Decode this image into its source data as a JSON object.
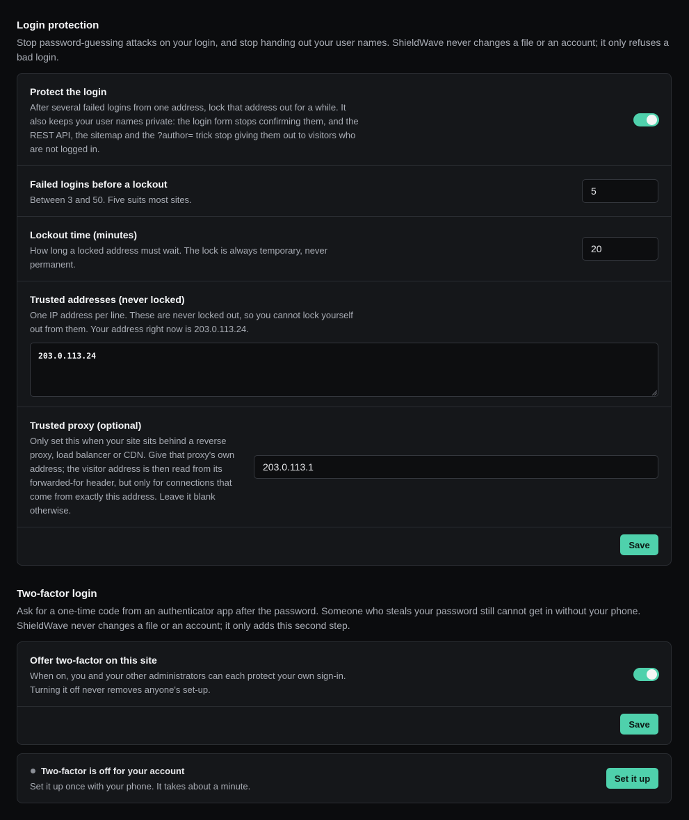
{
  "login_protection": {
    "title": "Login protection",
    "description": "Stop password-guessing attacks on your login, and stop handing out your user names. ShieldWave never changes a file or an account; it only refuses a bad login.",
    "protect": {
      "title": "Protect the login",
      "description": "After several failed logins from one address, lock that address out for a while. It also keeps your user names private: the login form stops confirming them, and the REST API, the sitemap and the ?author= trick stop giving them out to visitors who are not logged in.",
      "enabled": true
    },
    "failed_logins": {
      "title": "Failed logins before a lockout",
      "description": "Between 3 and 50. Five suits most sites.",
      "value": "5"
    },
    "lockout_time": {
      "title": "Lockout time (minutes)",
      "description": "How long a locked address must wait. The lock is always temporary, never permanent.",
      "value": "20"
    },
    "trusted_addresses": {
      "title": "Trusted addresses (never locked)",
      "description": "One IP address per line. These are never locked out, so you cannot lock yourself out from them. Your address right now is 203.0.113.24.",
      "value": "203.0.113.24"
    },
    "trusted_proxy": {
      "title": "Trusted proxy (optional)",
      "description": "Only set this when your site sits behind a reverse proxy, load balancer or CDN. Give that proxy's own address; the visitor address is then read from its forwarded-for header, but only for connections that come from exactly this address. Leave it blank otherwise.",
      "value": "203.0.113.1"
    },
    "save_label": "Save"
  },
  "two_factor": {
    "title": "Two-factor login",
    "description": "Ask for a one-time code from an authenticator app after the password. Someone who steals your password still cannot get in without your phone. ShieldWave never changes a file or an account; it only adds this second step.",
    "offer": {
      "title": "Offer two-factor on this site",
      "description": "When on, you and your other administrators can each protect your own sign-in. Turning it off never removes anyone's set-up.",
      "enabled": true
    },
    "save_label": "Save",
    "account": {
      "status_title": "Two-factor is off for your account",
      "status_description": "Set it up once with your phone. It takes about a minute.",
      "status_color": "#8b8f97",
      "setup_label": "Set it up"
    }
  },
  "colors": {
    "accent": "#4fd1ac",
    "background": "#0b0c0e",
    "card": "#15171a"
  }
}
